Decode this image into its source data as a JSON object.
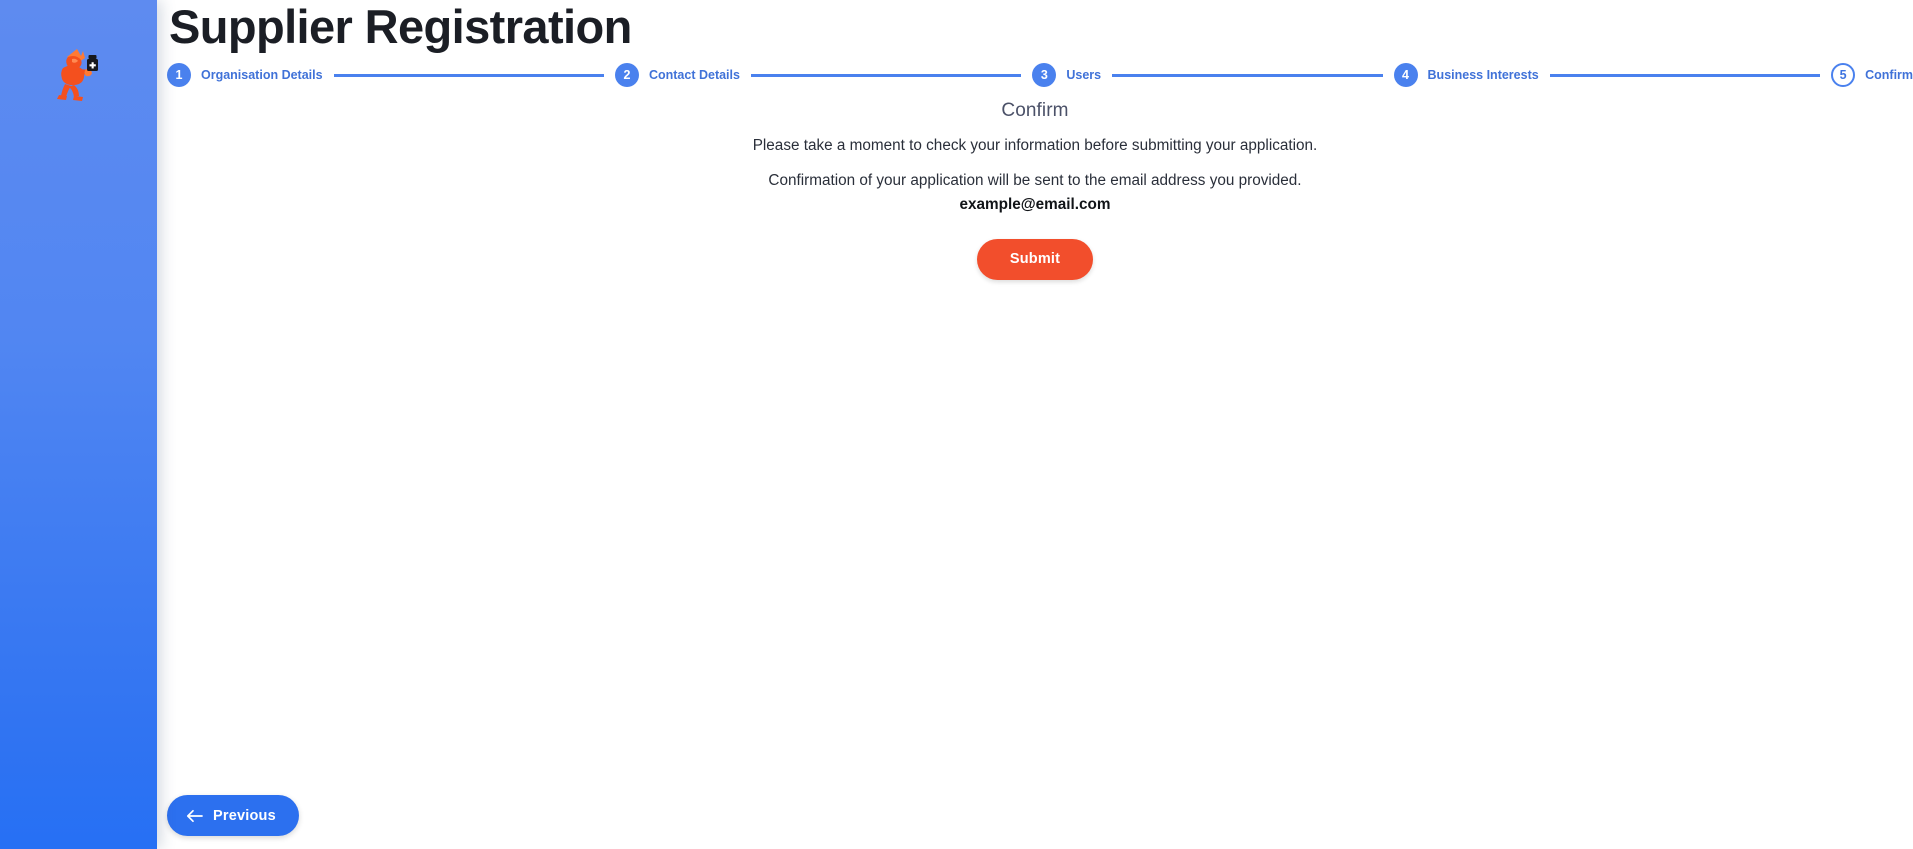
{
  "header": {
    "title": "Supplier Registration"
  },
  "brand": {
    "logo_icon": "running-person-with-jar-icon",
    "sidebar_color_top": "#5e8bf0",
    "sidebar_color_bottom": "#2670f4",
    "logo_color": "#f4501e",
    "logo_accent_color": "#ff7a3d"
  },
  "stepper": {
    "accent_color": "#4a81ee",
    "current_step": 5,
    "steps": [
      {
        "number": "1",
        "label": "Organisation Details",
        "state": "complete"
      },
      {
        "number": "2",
        "label": "Contact Details",
        "state": "complete"
      },
      {
        "number": "3",
        "label": "Users",
        "state": "complete"
      },
      {
        "number": "4",
        "label": "Business Interests",
        "state": "complete"
      },
      {
        "number": "5",
        "label": "Confirm",
        "state": "current"
      }
    ]
  },
  "content": {
    "heading": "Confirm",
    "line1": "Please take a moment to check your information before submitting your application.",
    "line2": "Confirmation of your application will be sent to the email address you provided.",
    "email": "example@email.com"
  },
  "actions": {
    "submit_label": "Submit",
    "submit_color": "#f24e2c",
    "previous_label": "Previous",
    "previous_color": "#2c70ef",
    "previous_icon": "arrow-left-icon"
  }
}
